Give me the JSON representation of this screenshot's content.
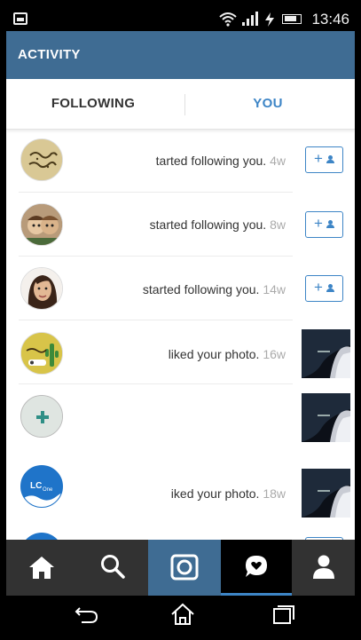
{
  "status_bar": {
    "time": "13:46",
    "icons": [
      "notification-icon",
      "wifi-icon",
      "signal-icon",
      "charging-icon",
      "battery-icon"
    ]
  },
  "app_bar": {
    "title": "ACTIVITY"
  },
  "tabs": [
    {
      "label": "FOLLOWING",
      "active": false
    },
    {
      "label": "YOU",
      "active": true
    }
  ],
  "activity": [
    {
      "text": "started following you.",
      "time": "4w",
      "action": "follow-button",
      "visible_text": "tarted following you."
    },
    {
      "text": "started following you.",
      "time": "8w",
      "action": "follow-button"
    },
    {
      "text": "started following you.",
      "time": "14w",
      "action": "follow-button"
    },
    {
      "text": "liked your photo.",
      "time": "16w",
      "action": "photo-thumbnail"
    },
    {
      "text": "",
      "time": "",
      "action": "photo-thumbnail"
    },
    {
      "text": "liked your photo.",
      "time": "18w",
      "action": "photo-thumbnail",
      "visible_text": "iked your photo."
    }
  ],
  "avatar_labels": {
    "lc_one_top": "LC",
    "lc_one_bottom": "One"
  },
  "bottom_tabs": [
    "home-icon",
    "search-icon",
    "camera-icon",
    "activity-icon",
    "profile-icon"
  ],
  "nav_buttons": [
    "back-icon",
    "home-nav-icon",
    "recent-apps-icon"
  ],
  "colors": {
    "app_bar": "#3f6c93",
    "accent": "#3d85c6",
    "tab_bar": "#323232"
  }
}
